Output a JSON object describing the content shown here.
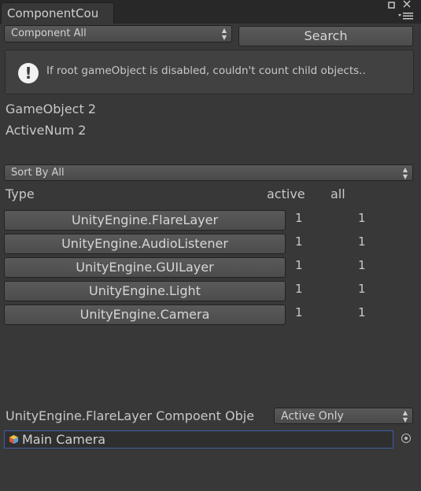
{
  "window": {
    "tab_title": "ComponentCou",
    "maximize_icon": "square-icon",
    "close_icon": "close-icon",
    "menu_icon": "hamburger-menu-icon"
  },
  "toolbar": {
    "component_filter": "Component All",
    "search_label": "Search"
  },
  "help": {
    "icon": "warning-icon",
    "message": "If root gameObject is disabled, couldn't count child objects.."
  },
  "stats": {
    "gameobject_count": "GameObject 2",
    "active_count": "ActiveNum 2"
  },
  "sort": {
    "selected": "Sort By All"
  },
  "table": {
    "headers": {
      "type": "Type",
      "active": "active",
      "all": "all"
    },
    "rows": [
      {
        "type": "UnityEngine.FlareLayer",
        "active": "1",
        "all": "1"
      },
      {
        "type": "UnityEngine.AudioListener",
        "active": "1",
        "all": "1"
      },
      {
        "type": "UnityEngine.GUILayer",
        "active": "1",
        "all": "1"
      },
      {
        "type": "UnityEngine.Light",
        "active": "1",
        "all": "1"
      },
      {
        "type": "UnityEngine.Camera",
        "active": "1",
        "all": "1"
      }
    ]
  },
  "detail": {
    "label": "UnityEngine.FlareLayer Compoent Obje",
    "filter": "Active Only",
    "object_name": "Main Camera",
    "object_icon": "gameobject-cube-icon",
    "picker_icon": "object-picker-icon"
  },
  "colors": {
    "background": "#383838",
    "selection_border": "#3d5fa6"
  }
}
